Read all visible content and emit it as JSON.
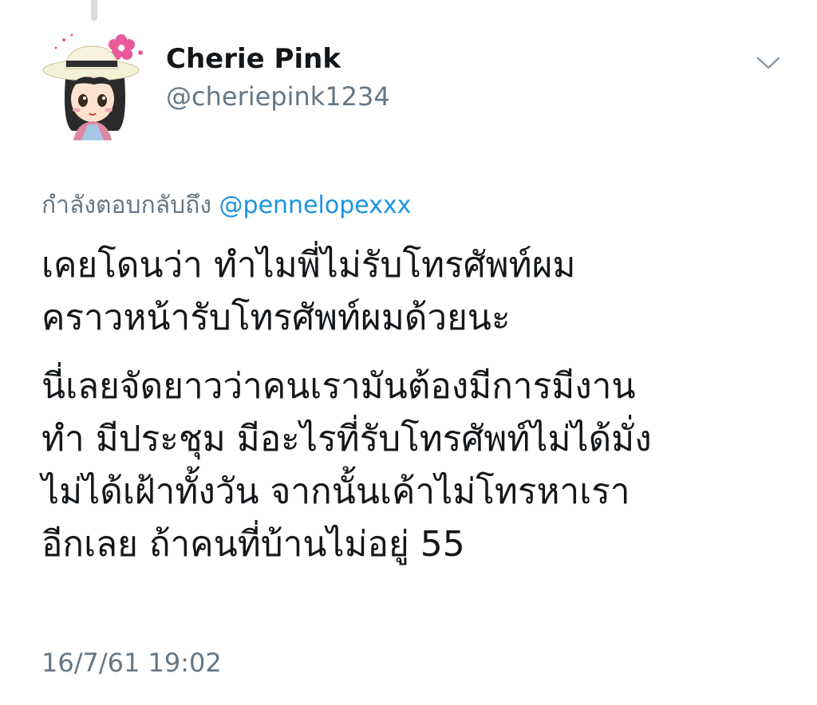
{
  "tweet": {
    "author": {
      "display_name": "Cherie Pink",
      "handle": "@cheriepink1234"
    },
    "reply_prefix": "กำลังตอบกลับถึง",
    "reply_mention": "@pennelopexxx",
    "lines": [
      "เคยโดนว่า ทำไมพี่ไม่รับโทรศัพท์ผม",
      "คราวหน้ารับโทรศัพท์ผมด้วยนะ",
      "นี่เลยจัดยาวว่าคนเรามันต้องมีการมีงาน",
      "ทำ มีประชุม มีอะไรที่รับโทรศัพท์ไม่ได้มั่ง",
      "ไม่ได้เฝ้าทั้งวัน จากนั้นเค้าไม่โทรหาเรา",
      "อีกเลย ถ้าคนที่บ้านไม่อยู่ 55"
    ],
    "timestamp": "16/7/61 19:02"
  },
  "icons": {
    "more": "chevron-down-icon",
    "avatar": "avatar-cartoon-girl"
  },
  "colors": {
    "text": "#14171a",
    "secondary": "#657786",
    "link": "#1b95e0",
    "accent": "#e85b9a"
  }
}
